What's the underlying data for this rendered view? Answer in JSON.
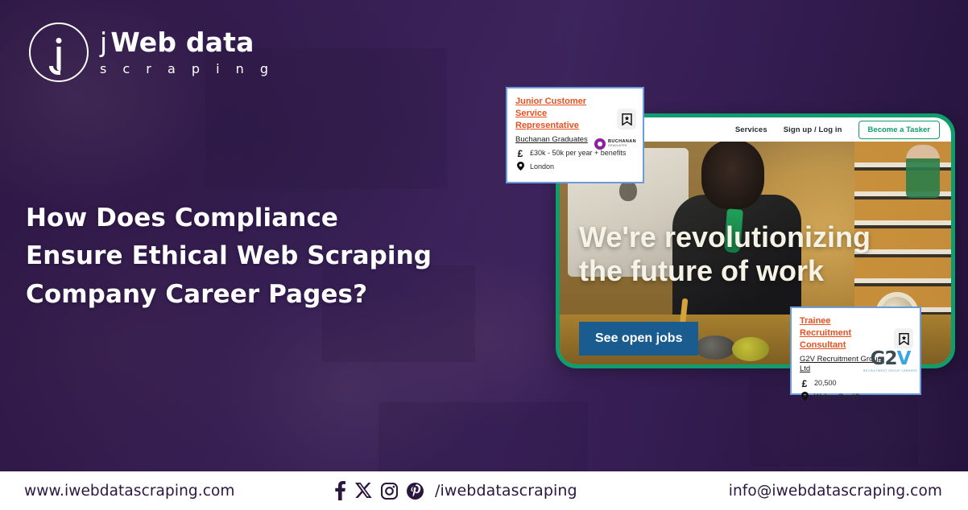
{
  "brand": {
    "logo_mark": "j-circle-icon",
    "name_line1_prefix": "j",
    "name_line1": "Web data",
    "name_line2": "s c r a p i n g"
  },
  "headline": {
    "line1": "How Does Compliance",
    "line2": "Ensure Ethical Web Scraping",
    "line3": "Company Career Pages?"
  },
  "site_panel": {
    "nav": {
      "services": "Services",
      "signup_login": "Sign up / Log in",
      "become_tasker": "Become a Tasker"
    },
    "hero_line1": "We're revolutionizing",
    "hero_line2": "the future of work",
    "cta_label": "See open jobs",
    "border_color": "#0f9d6e",
    "cta_color": "#1a5c8f"
  },
  "job_cards": [
    {
      "title": "Junior Customer Service Representative",
      "company": "Buchanan Graduates",
      "salary_icon": "£",
      "salary": "£30k - 50k per year + benefits",
      "location_icon": "location-pin-icon",
      "location": "London",
      "bookmark_icon": "bookmark-star-icon",
      "logo_name": "buchanan-graduates-logo",
      "logo_text_main": "BUCHANAN",
      "logo_text_sub": "GRADUATES",
      "title_color": "#e8501f",
      "border_color": "#6b9bd8"
    },
    {
      "title": "Trainee Recruitment Consultant",
      "company": "G2V Recruitment Group Ltd",
      "salary_icon": "£",
      "salary": "20,500",
      "location_icon": "location-pin-icon",
      "location": "Wales, Cardiff",
      "bookmark_icon": "bookmark-star-icon",
      "logo_name": "g2v-recruitment-logo",
      "logo_text_main_g": "G2",
      "logo_text_main_v": "V",
      "logo_text_sub": "RECRUITMENT GROUP CAREERS",
      "title_color": "#e8501f",
      "border_color": "#6b9bd8"
    }
  ],
  "footer": {
    "website": "www.iwebdatascraping.com",
    "social_icons": [
      "facebook-icon",
      "x-twitter-icon",
      "instagram-icon",
      "pinterest-icon"
    ],
    "handle": "/iwebdatascraping",
    "email": "info@iwebdatascraping.com",
    "text_color": "#2b1640"
  }
}
